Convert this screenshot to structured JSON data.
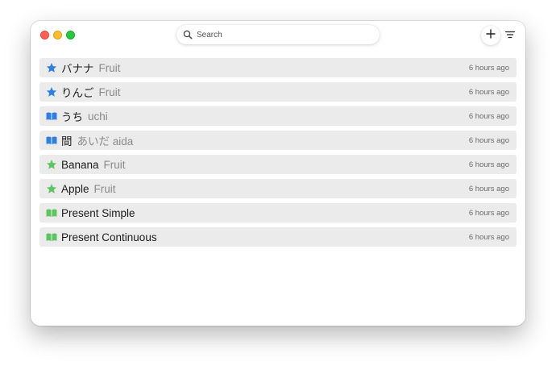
{
  "search": {
    "placeholder": "Search"
  },
  "colors": {
    "blue": "#2f7fe0",
    "green": "#5ec460",
    "row_bg": "#ebebeb"
  },
  "items": [
    {
      "icon": "star-icon",
      "color": "blue",
      "title": "バナナ",
      "subtitle": "Fruit",
      "time": "6 hours ago"
    },
    {
      "icon": "star-icon",
      "color": "blue",
      "title": "りんご",
      "subtitle": "Fruit",
      "time": "6 hours ago"
    },
    {
      "icon": "book-icon",
      "color": "blue",
      "title": "うち",
      "subtitle": "uchi",
      "time": "6 hours ago"
    },
    {
      "icon": "book-icon",
      "color": "blue",
      "title": "間",
      "subtitle": "あいだ aida",
      "time": "6 hours ago"
    },
    {
      "icon": "star-icon",
      "color": "green",
      "title": "Banana",
      "subtitle": "Fruit",
      "time": "6 hours ago"
    },
    {
      "icon": "star-icon",
      "color": "green",
      "title": "Apple",
      "subtitle": "Fruit",
      "time": "6 hours ago"
    },
    {
      "icon": "book-icon",
      "color": "green",
      "title": "Present Simple",
      "subtitle": "",
      "time": "6 hours ago"
    },
    {
      "icon": "book-icon",
      "color": "green",
      "title": "Present Continuous",
      "subtitle": "",
      "time": "6 hours ago"
    }
  ]
}
